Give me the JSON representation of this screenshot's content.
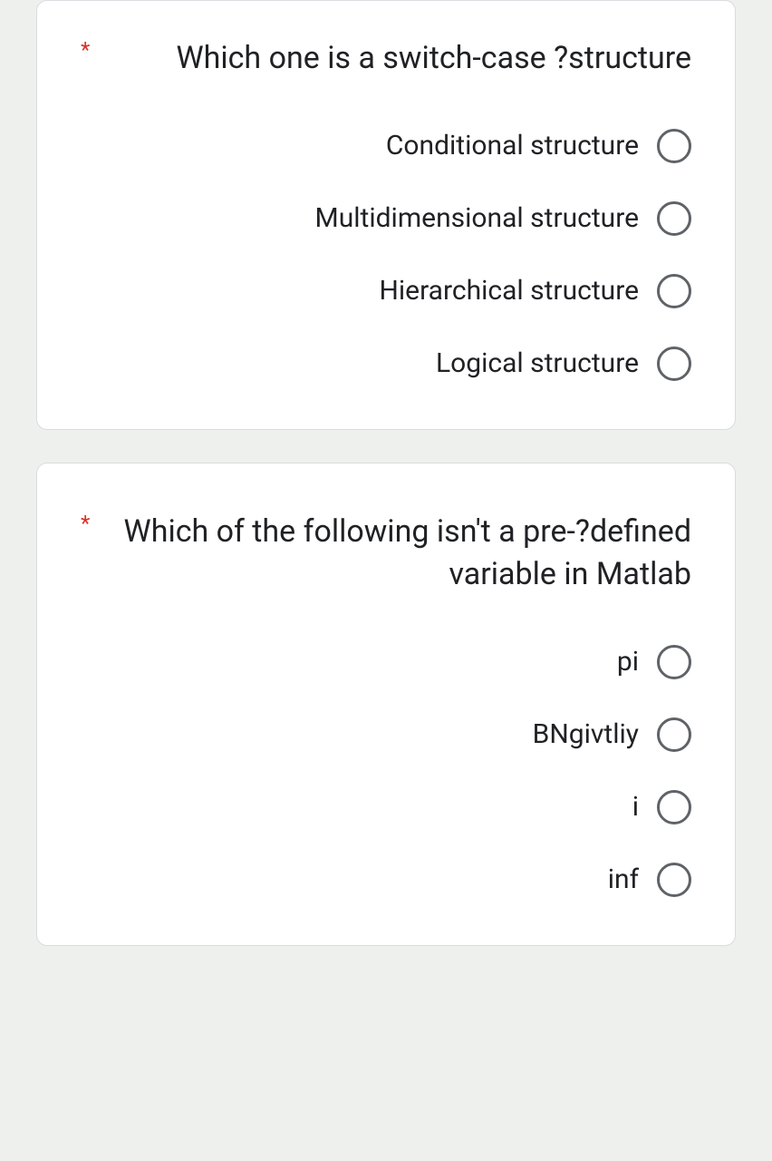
{
  "required_marker": "*",
  "questions": [
    {
      "text": "Which one is a switch-case ?structure",
      "options": [
        "Conditional structure",
        "Multidimensional structure",
        "Hierarchical structure",
        "Logical structure"
      ]
    },
    {
      "text": "Which of the following isn't a pre-?defined variable in Matlab",
      "options": [
        "pi",
        "BNgivtliy",
        "i",
        "inf"
      ]
    }
  ]
}
